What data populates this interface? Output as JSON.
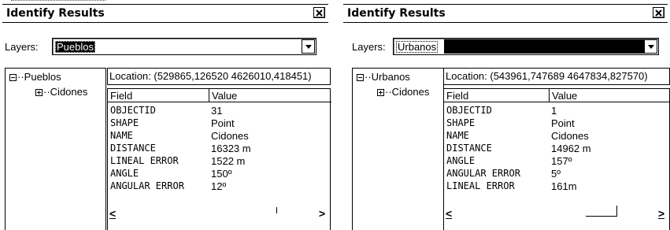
{
  "panels": [
    {
      "title": "Identify Results",
      "close_icon": "close-icon",
      "layers_label": "Layers:",
      "layer_selected": "Pueblos",
      "tree": {
        "root": "Pueblos",
        "child": "Cidones"
      },
      "location": "Location: (529865,126520 4626010,418451)",
      "columns": {
        "field": "Field",
        "value": "Value"
      },
      "rows": [
        {
          "field": "OBJECTID",
          "value": "31"
        },
        {
          "field": "SHAPE",
          "value": "Point"
        },
        {
          "field": "NAME",
          "value": "Cidones"
        },
        {
          "field": "DISTANCE",
          "value": "16323 m"
        },
        {
          "field": "LINEAL ERROR",
          "value": "1522 m"
        },
        {
          "field": "ANGLE",
          "value": "150º"
        },
        {
          "field": "ANGULAR ERROR",
          "value": "12º"
        }
      ],
      "scroll_left": "<",
      "scroll_right": ">"
    },
    {
      "title": "Identify Results",
      "close_icon": "close-icon",
      "layers_label": "Layers:",
      "layer_selected": "Urbanos",
      "tree": {
        "root": "Urbanos",
        "child": "Cidones"
      },
      "location": "Location: (543961,747689 4647834,827570)",
      "columns": {
        "field": "Field",
        "value": "Value"
      },
      "rows": [
        {
          "field": "OBJECTID",
          "value": "1"
        },
        {
          "field": "SHAPE",
          "value": "Point"
        },
        {
          "field": "NAME",
          "value": "Cidones"
        },
        {
          "field": "DISTANCE",
          "value": "14962 m"
        },
        {
          "field": "ANGLE",
          "value": "157º"
        },
        {
          "field": "ANGULAR ERROR",
          "value": "5º"
        },
        {
          "field": "LINEAL ERROR",
          "value": "161m"
        }
      ],
      "scroll_left": "<",
      "scroll_right": ">"
    }
  ]
}
